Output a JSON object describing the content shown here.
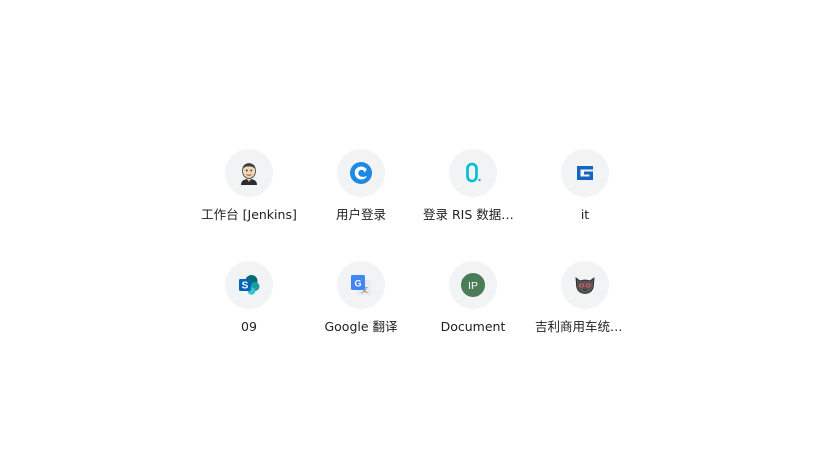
{
  "shortcuts": [
    {
      "label": "工作台 [Jenkins]",
      "icon": "jenkins-icon"
    },
    {
      "label": "用户登录",
      "icon": "swirl-logo-icon"
    },
    {
      "label": "登录 RIS 数据平台",
      "icon": "ris-logo-icon"
    },
    {
      "label": "it",
      "icon": "g-logo-icon"
    },
    {
      "label": "09",
      "icon": "sharepoint-icon"
    },
    {
      "label": "Google 翻译",
      "icon": "google-translate-icon"
    },
    {
      "label": "Document",
      "icon": "ip-letter-icon",
      "icon_text": "IP",
      "icon_color": "#4a7c59"
    },
    {
      "label": "吉利商用车统一平台",
      "icon": "cat-face-icon"
    }
  ],
  "colors": {
    "tile_bg": "#f1f3f4",
    "label_text": "#202124",
    "swirl_blue": "#1e88e5",
    "ris_cyan": "#00bcd4",
    "g_blue": "#1565c0",
    "sharepoint_blue": "#0364b8",
    "translate_blue": "#4285f4"
  }
}
